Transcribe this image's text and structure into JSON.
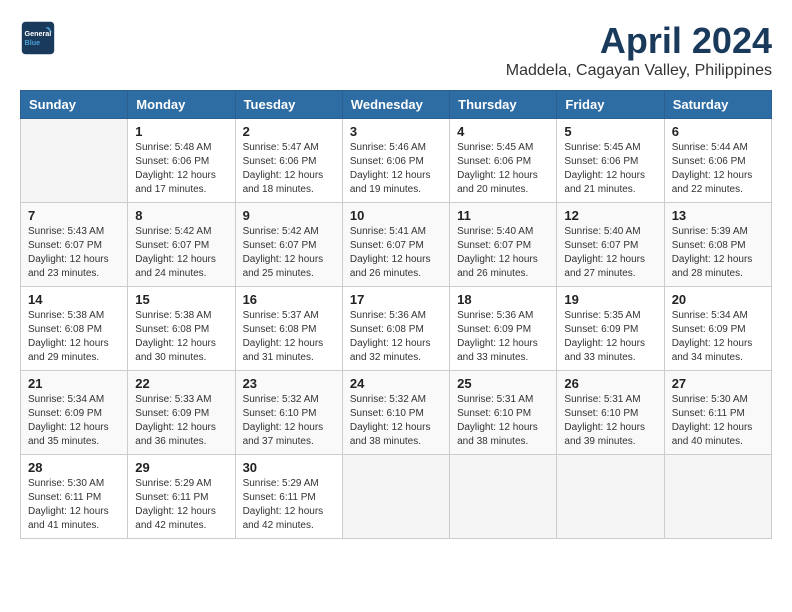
{
  "logo": {
    "line1": "General",
    "line2": "Blue"
  },
  "title": "April 2024",
  "location": "Maddela, Cagayan Valley, Philippines",
  "headers": [
    "Sunday",
    "Monday",
    "Tuesday",
    "Wednesday",
    "Thursday",
    "Friday",
    "Saturday"
  ],
  "weeks": [
    [
      {
        "day": "",
        "info": ""
      },
      {
        "day": "1",
        "info": "Sunrise: 5:48 AM\nSunset: 6:06 PM\nDaylight: 12 hours\nand 17 minutes."
      },
      {
        "day": "2",
        "info": "Sunrise: 5:47 AM\nSunset: 6:06 PM\nDaylight: 12 hours\nand 18 minutes."
      },
      {
        "day": "3",
        "info": "Sunrise: 5:46 AM\nSunset: 6:06 PM\nDaylight: 12 hours\nand 19 minutes."
      },
      {
        "day": "4",
        "info": "Sunrise: 5:45 AM\nSunset: 6:06 PM\nDaylight: 12 hours\nand 20 minutes."
      },
      {
        "day": "5",
        "info": "Sunrise: 5:45 AM\nSunset: 6:06 PM\nDaylight: 12 hours\nand 21 minutes."
      },
      {
        "day": "6",
        "info": "Sunrise: 5:44 AM\nSunset: 6:06 PM\nDaylight: 12 hours\nand 22 minutes."
      }
    ],
    [
      {
        "day": "7",
        "info": "Sunrise: 5:43 AM\nSunset: 6:07 PM\nDaylight: 12 hours\nand 23 minutes."
      },
      {
        "day": "8",
        "info": "Sunrise: 5:42 AM\nSunset: 6:07 PM\nDaylight: 12 hours\nand 24 minutes."
      },
      {
        "day": "9",
        "info": "Sunrise: 5:42 AM\nSunset: 6:07 PM\nDaylight: 12 hours\nand 25 minutes."
      },
      {
        "day": "10",
        "info": "Sunrise: 5:41 AM\nSunset: 6:07 PM\nDaylight: 12 hours\nand 26 minutes."
      },
      {
        "day": "11",
        "info": "Sunrise: 5:40 AM\nSunset: 6:07 PM\nDaylight: 12 hours\nand 26 minutes."
      },
      {
        "day": "12",
        "info": "Sunrise: 5:40 AM\nSunset: 6:07 PM\nDaylight: 12 hours\nand 27 minutes."
      },
      {
        "day": "13",
        "info": "Sunrise: 5:39 AM\nSunset: 6:08 PM\nDaylight: 12 hours\nand 28 minutes."
      }
    ],
    [
      {
        "day": "14",
        "info": "Sunrise: 5:38 AM\nSunset: 6:08 PM\nDaylight: 12 hours\nand 29 minutes."
      },
      {
        "day": "15",
        "info": "Sunrise: 5:38 AM\nSunset: 6:08 PM\nDaylight: 12 hours\nand 30 minutes."
      },
      {
        "day": "16",
        "info": "Sunrise: 5:37 AM\nSunset: 6:08 PM\nDaylight: 12 hours\nand 31 minutes."
      },
      {
        "day": "17",
        "info": "Sunrise: 5:36 AM\nSunset: 6:08 PM\nDaylight: 12 hours\nand 32 minutes."
      },
      {
        "day": "18",
        "info": "Sunrise: 5:36 AM\nSunset: 6:09 PM\nDaylight: 12 hours\nand 33 minutes."
      },
      {
        "day": "19",
        "info": "Sunrise: 5:35 AM\nSunset: 6:09 PM\nDaylight: 12 hours\nand 33 minutes."
      },
      {
        "day": "20",
        "info": "Sunrise: 5:34 AM\nSunset: 6:09 PM\nDaylight: 12 hours\nand 34 minutes."
      }
    ],
    [
      {
        "day": "21",
        "info": "Sunrise: 5:34 AM\nSunset: 6:09 PM\nDaylight: 12 hours\nand 35 minutes."
      },
      {
        "day": "22",
        "info": "Sunrise: 5:33 AM\nSunset: 6:09 PM\nDaylight: 12 hours\nand 36 minutes."
      },
      {
        "day": "23",
        "info": "Sunrise: 5:32 AM\nSunset: 6:10 PM\nDaylight: 12 hours\nand 37 minutes."
      },
      {
        "day": "24",
        "info": "Sunrise: 5:32 AM\nSunset: 6:10 PM\nDaylight: 12 hours\nand 38 minutes."
      },
      {
        "day": "25",
        "info": "Sunrise: 5:31 AM\nSunset: 6:10 PM\nDaylight: 12 hours\nand 38 minutes."
      },
      {
        "day": "26",
        "info": "Sunrise: 5:31 AM\nSunset: 6:10 PM\nDaylight: 12 hours\nand 39 minutes."
      },
      {
        "day": "27",
        "info": "Sunrise: 5:30 AM\nSunset: 6:11 PM\nDaylight: 12 hours\nand 40 minutes."
      }
    ],
    [
      {
        "day": "28",
        "info": "Sunrise: 5:30 AM\nSunset: 6:11 PM\nDaylight: 12 hours\nand 41 minutes."
      },
      {
        "day": "29",
        "info": "Sunrise: 5:29 AM\nSunset: 6:11 PM\nDaylight: 12 hours\nand 42 minutes."
      },
      {
        "day": "30",
        "info": "Sunrise: 5:29 AM\nSunset: 6:11 PM\nDaylight: 12 hours\nand 42 minutes."
      },
      {
        "day": "",
        "info": ""
      },
      {
        "day": "",
        "info": ""
      },
      {
        "day": "",
        "info": ""
      },
      {
        "day": "",
        "info": ""
      }
    ]
  ]
}
